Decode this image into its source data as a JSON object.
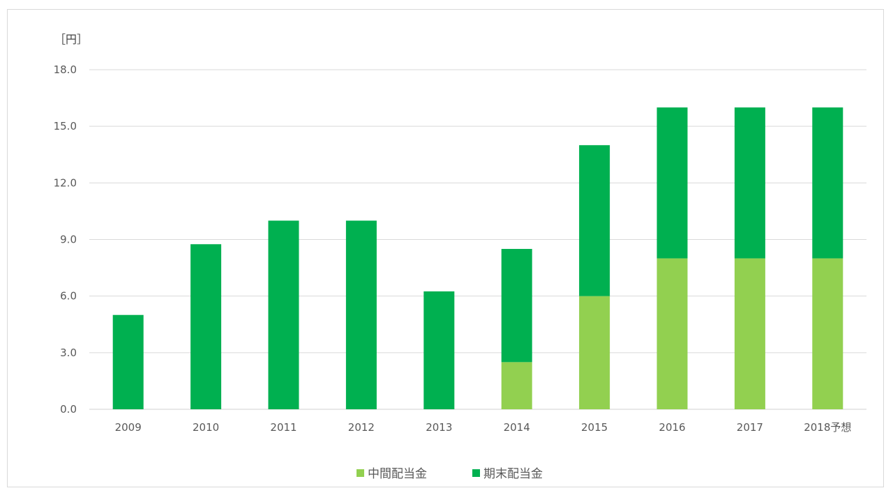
{
  "chart_data": {
    "type": "bar",
    "stacked": true,
    "ylabel": "［円］",
    "ylim": [
      0,
      18
    ],
    "yticks": [
      "0.0",
      "3.0",
      "6.0",
      "9.0",
      "12.0",
      "15.0",
      "18.0"
    ],
    "grid": true,
    "legend_position": "bottom",
    "categories": [
      "2009",
      "2010",
      "2011",
      "2012",
      "2013",
      "2014",
      "2015",
      "2016",
      "2017",
      "2018予想"
    ],
    "series": [
      {
        "name": "中間配当金",
        "color": "#92d050",
        "values": [
          0,
          0,
          0,
          0,
          0,
          2.5,
          6,
          8,
          8,
          8
        ]
      },
      {
        "name": "期末配当金",
        "color": "#00b050",
        "values": [
          5,
          8.75,
          10,
          10,
          6.25,
          6,
          8,
          8,
          8,
          8
        ]
      }
    ]
  }
}
